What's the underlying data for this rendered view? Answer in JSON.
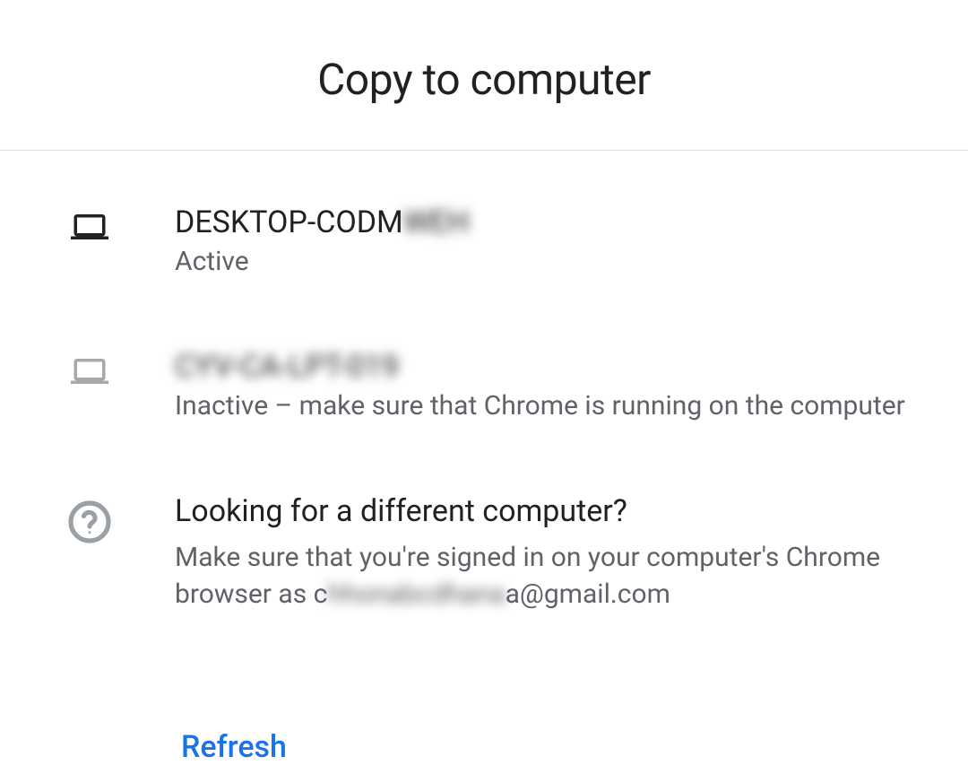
{
  "header": {
    "title": "Copy to computer"
  },
  "devices": [
    {
      "name_visible": "DESKTOP-CODM",
      "name_blurred": "WEH",
      "status": "Active",
      "active": true
    },
    {
      "name_visible": "",
      "name_blurred": "CYV-CA-LPT-019",
      "status": "Inactive – make sure that Chrome is running on the computer",
      "active": false
    }
  ],
  "help": {
    "title": "Looking for a different computer?",
    "text_prefix": "Make sure that you're signed in on your computer's Chrome browser as c",
    "text_blurred": "hhonabcdhana",
    "text_suffix": "a@gmail.com"
  },
  "actions": {
    "refresh": "Refresh"
  }
}
